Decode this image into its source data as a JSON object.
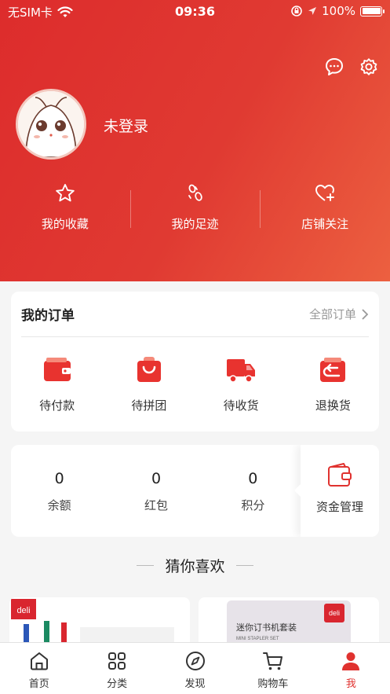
{
  "status_bar": {
    "carrier": "无SIM卡",
    "time": "09:36",
    "battery": "100%"
  },
  "profile": {
    "username": "未登录"
  },
  "quick_links": [
    {
      "label": "我的收藏",
      "icon": "star-icon"
    },
    {
      "label": "我的足迹",
      "icon": "footprint-icon"
    },
    {
      "label": "店铺关注",
      "icon": "heart-plus-icon"
    }
  ],
  "orders": {
    "title": "我的订单",
    "all_label": "全部订单",
    "items": [
      {
        "label": "待付款",
        "icon": "wallet-icon"
      },
      {
        "label": "待拼团",
        "icon": "shopping-bag-icon"
      },
      {
        "label": "待收货",
        "icon": "truck-icon"
      },
      {
        "label": "退换货",
        "icon": "return-icon"
      }
    ]
  },
  "assets": {
    "items": [
      {
        "value": "0",
        "label": "余额"
      },
      {
        "value": "0",
        "label": "红包"
      },
      {
        "value": "0",
        "label": "积分"
      }
    ],
    "fund_label": "资金管理"
  },
  "recommend": {
    "title": "猜你喜欢"
  },
  "products": {
    "p2_title": "迷你订书机套装",
    "p2_subtitle": "MINI STAPLER SET",
    "brand": "deli"
  },
  "tabbar": [
    {
      "label": "首页",
      "icon": "home-icon"
    },
    {
      "label": "分类",
      "icon": "grid-icon"
    },
    {
      "label": "发现",
      "icon": "compass-icon"
    },
    {
      "label": "购物车",
      "icon": "cart-icon"
    },
    {
      "label": "我",
      "icon": "user-icon",
      "active": true
    }
  ],
  "colors": {
    "accent": "#e0322f",
    "header_start": "#dd2c2c",
    "header_end": "#ec6040"
  }
}
